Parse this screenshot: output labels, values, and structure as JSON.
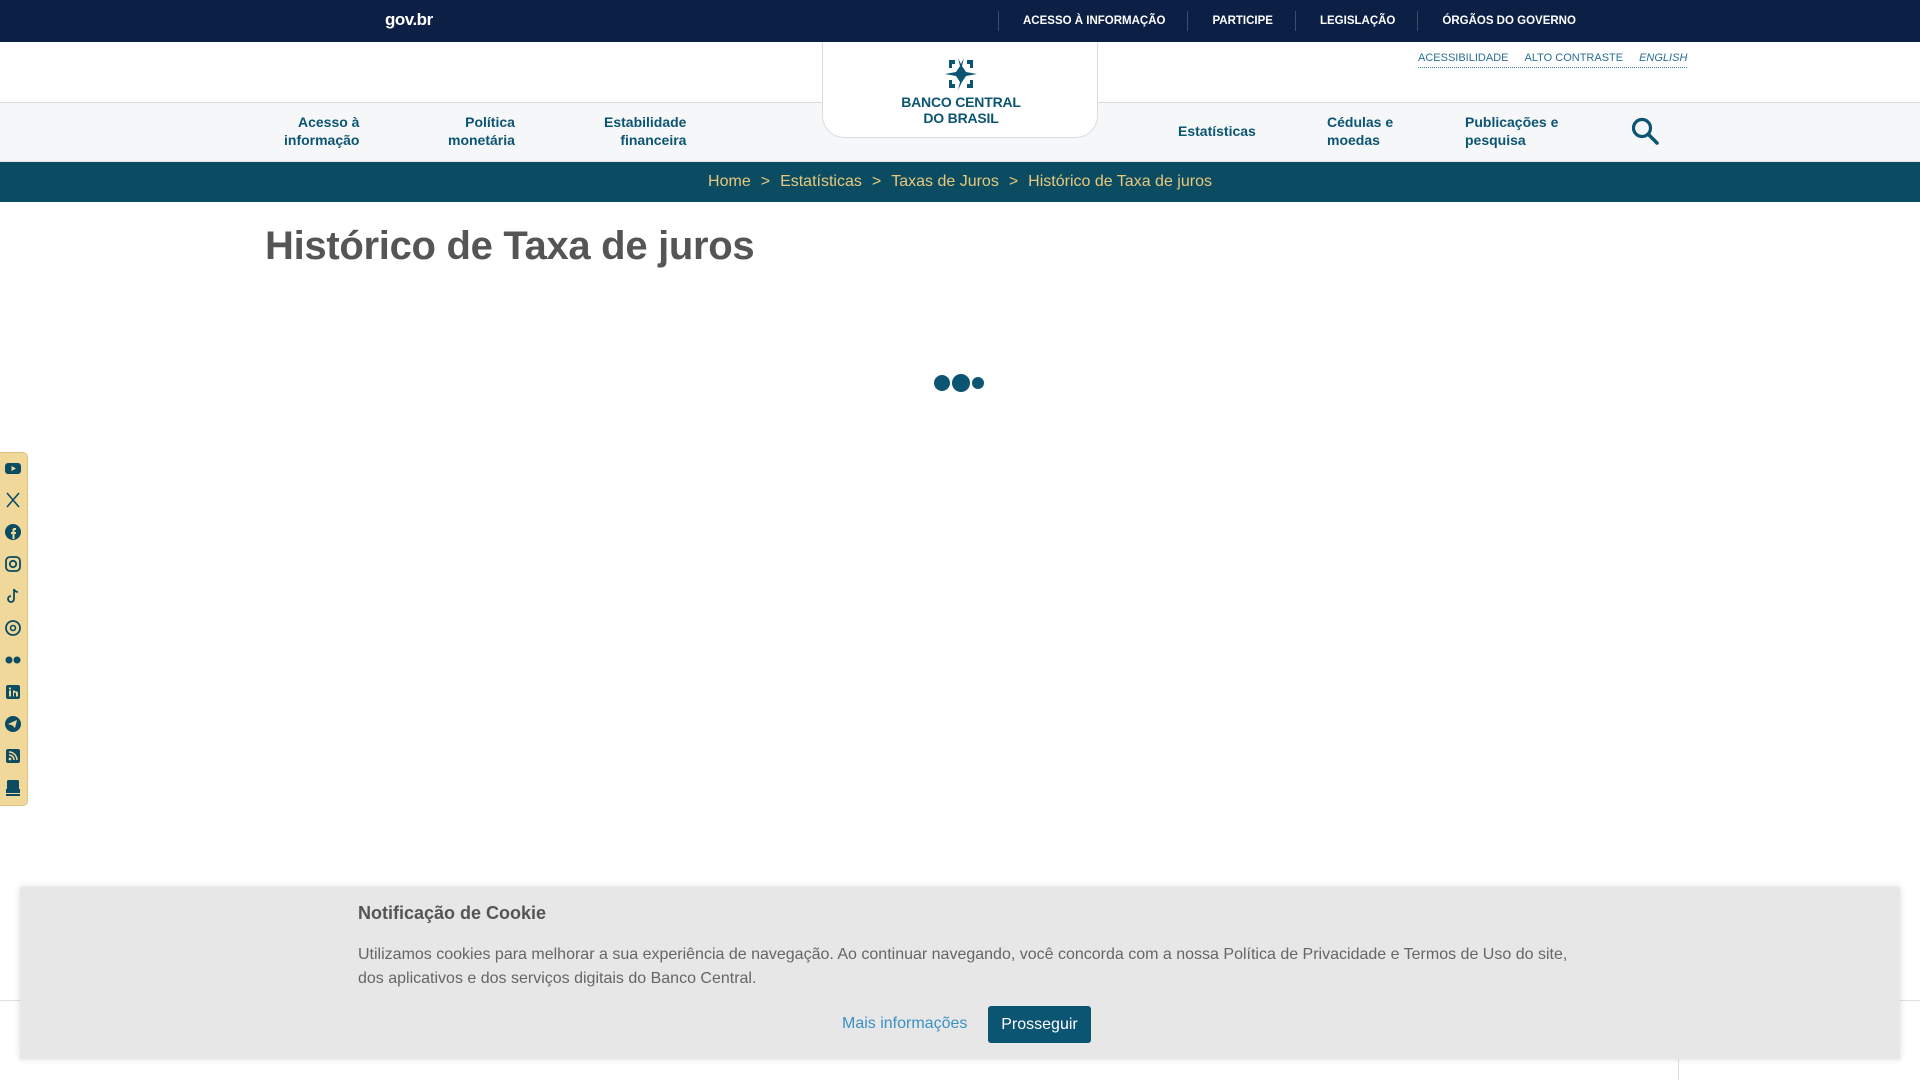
{
  "govbar": {
    "logo": "gov.br",
    "links": [
      "ACESSO À INFORMAÇÃO",
      "PARTICIPE",
      "LEGISLAÇÃO",
      "ÓRGÃOS DO GOVERNO"
    ]
  },
  "utility": {
    "accessibility": "ACESSIBILIDADE",
    "high_contrast": "ALTO CONTRASTE",
    "english": "ENGLISH"
  },
  "brand": {
    "line1": "BANCO CENTRAL",
    "line2": "DO BRASIL"
  },
  "nav": {
    "acesso": [
      "Acesso à",
      "informação"
    ],
    "politica": [
      "Política",
      "monetária"
    ],
    "estabilidade": [
      "Estabilidade",
      "financeira"
    ],
    "estatisticas": [
      "Estatísticas"
    ],
    "cedulas": [
      "Cédulas e",
      "moedas"
    ],
    "publicacoes": [
      "Publicações e",
      "pesquisa"
    ]
  },
  "breadcrumb": [
    "Home",
    "Estatísticas",
    "Taxas de Juros",
    "Histórico de Taxa de juros"
  ],
  "breadcrumb_separator": ">",
  "page": {
    "title": "Histórico de Taxa de juros"
  },
  "social": [
    "youtube-icon",
    "x-icon",
    "facebook-icon",
    "instagram-icon",
    "tiktok-icon",
    "threads-icon",
    "flickr-icon",
    "linkedin-icon",
    "telegram-icon",
    "rss-icon",
    "news-icon"
  ],
  "cookie": {
    "title": "Notificação de Cookie",
    "text": "Utilizamos cookies para melhorar a sua experiência de navegação. Ao continuar navegando, você concorda com a nossa Política de Privacidade e Termos de Uso do site, dos aplicativos e dos serviços digitais do Banco Central.",
    "more": "Mais informações",
    "accept": "Prosseguir"
  },
  "colors": {
    "govbar": "#0c1f44",
    "primary": "#0b5573",
    "breadcrumb_bg": "#0b4c63",
    "breadcrumb_text": "#e8c87a",
    "social_bg": "#f0d79a"
  }
}
